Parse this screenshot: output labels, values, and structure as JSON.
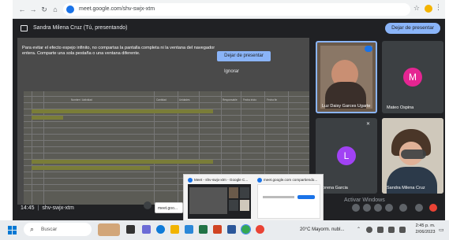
{
  "browser": {
    "back_icon": "arrow-left-icon",
    "forward_icon": "arrow-right-icon",
    "reload_icon": "reload-icon",
    "url": "meet.google.com/shv-swjx-xtm"
  },
  "meet": {
    "presenting_title": "Sandra Milena Cruz (Tú, presentando)",
    "stop_presenting_top": "Dejar de presentar",
    "warning_text": "Para evitar el efecto espejo infinito, no compartas la pantalla completa ni la ventana del navegador entera. Comparte una sola pestaña o una ventana diferente.",
    "stop_presenting_dialog": "Dejar de presentar",
    "ignore_label": "Ignorar",
    "sheet_headers": [
      "Nombre / Actividad",
      "Cantidad",
      "Unidades",
      "Responsable",
      "Fecha inicio",
      "Fecha fin"
    ],
    "participants": [
      {
        "name": "Luz Daisy Garces Ugarte",
        "type": "video"
      },
      {
        "name": "Mateo Ospina",
        "initial": "M",
        "avatar_color": "#e52592"
      },
      {
        "name": "Lorena Garcia",
        "initial": "L",
        "avatar_color": "#a142f4"
      },
      {
        "name": "Sandra Milena Cruz",
        "type": "video"
      }
    ],
    "time": "14:45",
    "meeting_code": "shv-swjx-xtm",
    "activar_windows": "Activar Windows",
    "activar_sub": "Ve a Configuración para activar Windows."
  },
  "preview": {
    "items": [
      {
        "title": "Meet - shv-swjx-xtm - Google C..."
      },
      {
        "title": "meet.google.com compartiendo..."
      }
    ],
    "tab_label": "meet.goo..."
  },
  "taskbar": {
    "search_label": "Buscar",
    "weather": "20°C Mayorm. nubl...",
    "time": "2:45 p. m.",
    "date": "2/06/2023"
  }
}
